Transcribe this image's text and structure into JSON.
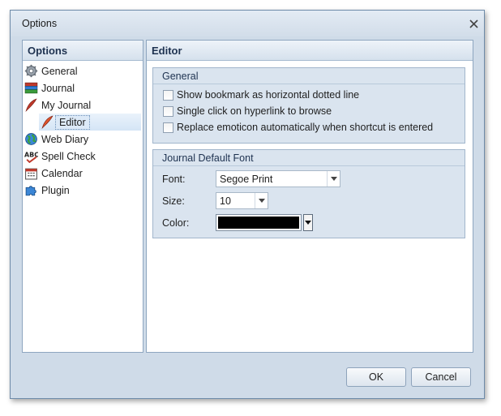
{
  "window": {
    "title": "Options"
  },
  "sidebar": {
    "header": "Options",
    "items": [
      {
        "label": "General",
        "icon": "gear-icon"
      },
      {
        "label": "Journal",
        "icon": "books-icon"
      },
      {
        "label": "My Journal",
        "icon": "quill-icon"
      },
      {
        "label": "Editor",
        "icon": "quill-icon",
        "selected": true
      },
      {
        "label": "Web Diary",
        "icon": "globe-icon"
      },
      {
        "label": "Spell Check",
        "icon": "abc-spellcheck-icon"
      },
      {
        "label": "Calendar",
        "icon": "calendar-icon"
      },
      {
        "label": "Plugin",
        "icon": "puzzle-piece-icon"
      }
    ]
  },
  "main": {
    "header": "Editor",
    "general": {
      "title": "General",
      "options": [
        {
          "label": "Show bookmark as horizontal dotted line",
          "checked": false
        },
        {
          "label": "Single click on hyperlink to browse",
          "checked": false
        },
        {
          "label": "Replace emoticon automatically when shortcut is entered",
          "checked": false
        }
      ]
    },
    "font_group": {
      "title": "Journal Default Font",
      "font_label": "Font:",
      "font_value": "Segoe Print",
      "size_label": "Size:",
      "size_value": "10",
      "color_label": "Color:",
      "color_value": "#000000"
    }
  },
  "footer": {
    "ok_label": "OK",
    "cancel_label": "Cancel"
  }
}
